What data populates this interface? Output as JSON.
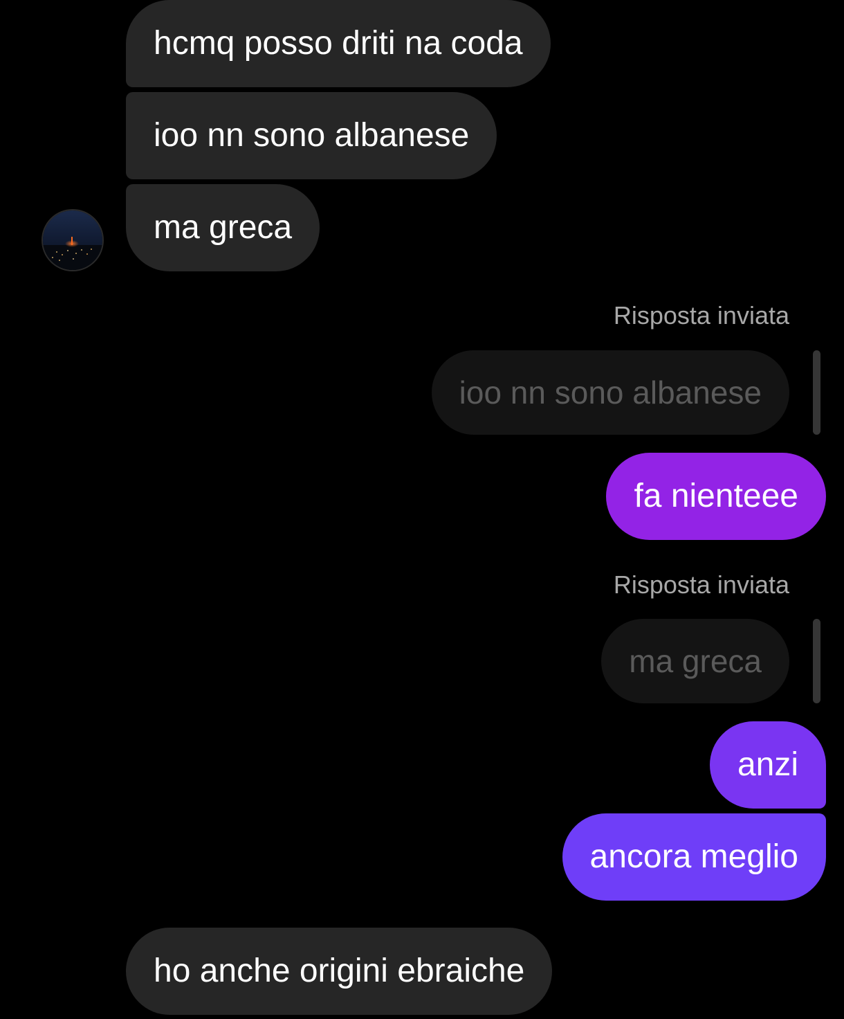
{
  "colors": {
    "background": "#000000",
    "incoming_bubble": "#262626",
    "sent_bubble_gradient_top": "#9323e6",
    "sent_bubble_gradient_bottom": "#6f3ef8",
    "reply_label": "#a8a8a8",
    "reply_preview_text": "#5a5a5a"
  },
  "contact": {
    "avatar_icon": "night-city-avatar"
  },
  "messages": {
    "in1": "hcmq posso driti na coda",
    "in2": "ioo nn sono albanese",
    "in3": "ma greca",
    "reply1_label": "Risposta inviata",
    "reply1_quote": "ioo nn sono albanese",
    "out1": "fa nienteee",
    "reply2_label": "Risposta inviata",
    "reply2_quote": "ma greca",
    "out2": "anzi",
    "out3": "ancora meglio",
    "in4": "ho anche origini ebraiche"
  }
}
